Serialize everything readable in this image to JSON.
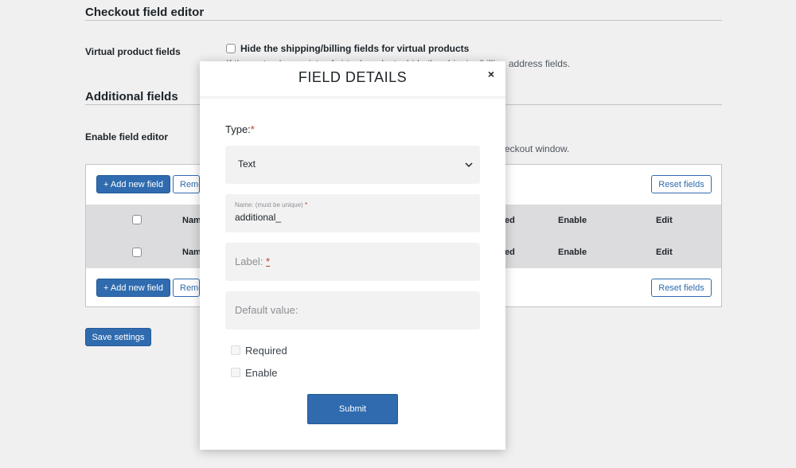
{
  "page": {
    "section1_title": "Checkout field editor",
    "virtual_label": "Virtual product fields",
    "virtual_checkbox_label": "Hide the shipping/billing fields for virtual products",
    "virtual_desc": "If the cart only consists of virtual products, hide the shipping/billing address fields.",
    "section2_title": "Additional fields",
    "enable_editor_label": "Enable field editor",
    "enable_editor_desc": "eckout window.",
    "add_new_field": "+ Add new field",
    "remove": "Remo",
    "reset_fields": "Reset fields",
    "table_headers": {
      "name": "Nam",
      "required": "ed",
      "enable": "Enable",
      "edit": "Edit"
    },
    "save_settings": "Save settings"
  },
  "modal": {
    "title": "FIELD DETAILS",
    "close": "×",
    "type_label": "Type:",
    "required_star": "*",
    "type_value": "Text",
    "name_label": "Name: (must be unique)",
    "name_value": "additional_",
    "label_placeholder": "Label:",
    "default_placeholder": "Default value:",
    "required_label": "Required",
    "enable_label": "Enable",
    "submit": "Submit"
  }
}
